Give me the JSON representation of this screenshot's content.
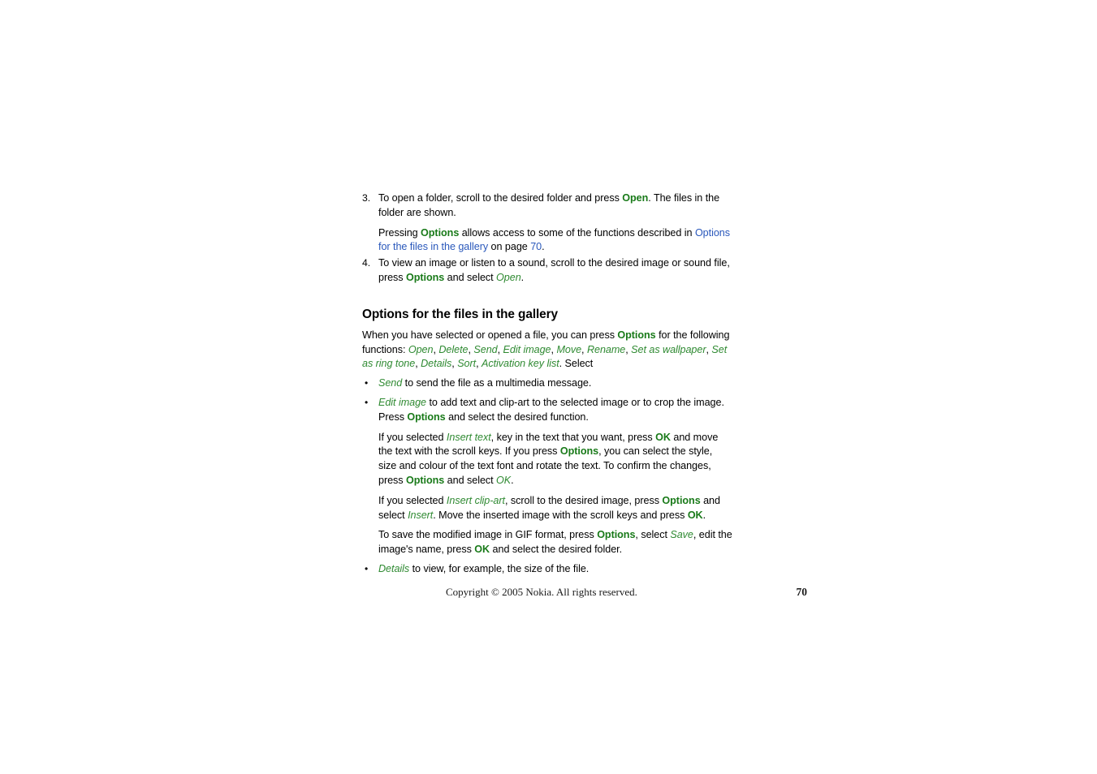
{
  "document": {
    "steps": [
      {
        "number": "3.",
        "segments": [
          {
            "t": "To open a folder, scroll to the desired folder and press ",
            "s": "plain"
          },
          {
            "t": "Open",
            "s": "key"
          },
          {
            "t": ". The files in the folder are shown.",
            "s": "plain"
          }
        ],
        "subparagraphs": [
          {
            "segments": [
              {
                "t": "Pressing ",
                "s": "plain"
              },
              {
                "t": "Options",
                "s": "key"
              },
              {
                "t": " allows access to some of the functions described in ",
                "s": "plain"
              },
              {
                "t": "Options for the files in the gallery",
                "s": "link"
              },
              {
                "t": " on page ",
                "s": "plain"
              },
              {
                "t": "70",
                "s": "link"
              },
              {
                "t": ".",
                "s": "plain"
              }
            ]
          }
        ]
      },
      {
        "number": "4.",
        "segments": [
          {
            "t": "To view an image or listen to a sound, scroll to the desired image or sound file, press ",
            "s": "plain"
          },
          {
            "t": "Options",
            "s": "key"
          },
          {
            "t": " and select ",
            "s": "plain"
          },
          {
            "t": "Open",
            "s": "menu"
          },
          {
            "t": ".",
            "s": "plain"
          }
        ],
        "subparagraphs": []
      }
    ],
    "section": {
      "heading": "Options for the files in the gallery",
      "intro_segments": [
        {
          "t": "When you have selected or opened a file, you can press ",
          "s": "plain"
        },
        {
          "t": "Options",
          "s": "key"
        },
        {
          "t": " for the following functions: ",
          "s": "plain"
        },
        {
          "t": "Open",
          "s": "menu"
        },
        {
          "t": ", ",
          "s": "plain"
        },
        {
          "t": "Delete",
          "s": "menu"
        },
        {
          "t": ", ",
          "s": "plain"
        },
        {
          "t": "Send",
          "s": "menu"
        },
        {
          "t": ", ",
          "s": "plain"
        },
        {
          "t": "Edit image",
          "s": "menu"
        },
        {
          "t": ", ",
          "s": "plain"
        },
        {
          "t": "Move",
          "s": "menu"
        },
        {
          "t": ", ",
          "s": "plain"
        },
        {
          "t": "Rename",
          "s": "menu"
        },
        {
          "t": ", ",
          "s": "plain"
        },
        {
          "t": "Set as wallpaper",
          "s": "menu"
        },
        {
          "t": ", ",
          "s": "plain"
        },
        {
          "t": "Set as ring tone",
          "s": "menu"
        },
        {
          "t": ", ",
          "s": "plain"
        },
        {
          "t": "Details",
          "s": "menu"
        },
        {
          "t": ", ",
          "s": "plain"
        },
        {
          "t": "Sort",
          "s": "menu"
        },
        {
          "t": ", ",
          "s": "plain"
        },
        {
          "t": "Activation key list",
          "s": "menu"
        },
        {
          "t": ". Select",
          "s": "plain"
        }
      ],
      "bullets": [
        {
          "marker": "•",
          "segments": [
            {
              "t": "Send",
              "s": "menu"
            },
            {
              "t": " to send the file as a multimedia message.",
              "s": "plain"
            }
          ],
          "paragraphs": []
        },
        {
          "marker": "•",
          "segments": [
            {
              "t": "Edit image",
              "s": "menu"
            },
            {
              "t": " to add text and clip-art to the selected image or to crop the image. Press ",
              "s": "plain"
            },
            {
              "t": "Options",
              "s": "key"
            },
            {
              "t": " and select the desired function.",
              "s": "plain"
            }
          ],
          "paragraphs": [
            {
              "segments": [
                {
                  "t": "If you selected ",
                  "s": "plain"
                },
                {
                  "t": "Insert text",
                  "s": "menu"
                },
                {
                  "t": ", key in the text that you want, press ",
                  "s": "plain"
                },
                {
                  "t": "OK",
                  "s": "key"
                },
                {
                  "t": " and move the text with the scroll keys. If you press ",
                  "s": "plain"
                },
                {
                  "t": "Options",
                  "s": "key"
                },
                {
                  "t": ", you can select the style, size and colour of the text font and rotate the text. To confirm the changes, press ",
                  "s": "plain"
                },
                {
                  "t": "Options",
                  "s": "key"
                },
                {
                  "t": " and select ",
                  "s": "plain"
                },
                {
                  "t": "OK",
                  "s": "menu"
                },
                {
                  "t": ".",
                  "s": "plain"
                }
              ]
            },
            {
              "segments": [
                {
                  "t": "If you selected ",
                  "s": "plain"
                },
                {
                  "t": "Insert clip-art",
                  "s": "menu"
                },
                {
                  "t": ", scroll to the desired image, press ",
                  "s": "plain"
                },
                {
                  "t": "Options",
                  "s": "key"
                },
                {
                  "t": " and select ",
                  "s": "plain"
                },
                {
                  "t": "Insert",
                  "s": "menu"
                },
                {
                  "t": ". Move the inserted image with the scroll keys and press ",
                  "s": "plain"
                },
                {
                  "t": "OK",
                  "s": "key"
                },
                {
                  "t": ".",
                  "s": "plain"
                }
              ]
            },
            {
              "segments": [
                {
                  "t": "To save the modified image in GIF format, press ",
                  "s": "plain"
                },
                {
                  "t": "Options",
                  "s": "key"
                },
                {
                  "t": ", select ",
                  "s": "plain"
                },
                {
                  "t": "Save",
                  "s": "menu"
                },
                {
                  "t": ", edit the image's name, press ",
                  "s": "plain"
                },
                {
                  "t": "OK",
                  "s": "key"
                },
                {
                  "t": " and select the desired folder.",
                  "s": "plain"
                }
              ]
            }
          ]
        },
        {
          "marker": "•",
          "segments": [
            {
              "t": "Details",
              "s": "menu"
            },
            {
              "t": " to view, for example, the size of the file.",
              "s": "plain"
            }
          ],
          "paragraphs": []
        }
      ]
    },
    "footer": {
      "copyright": "Copyright © 2005 Nokia. All rights reserved.",
      "page_number": "70"
    },
    "colors": {
      "key_green": "#197a19",
      "menu_green": "#2f8a32",
      "link_blue": "#2a58bb",
      "text_black": "#000000",
      "background": "#ffffff"
    }
  }
}
